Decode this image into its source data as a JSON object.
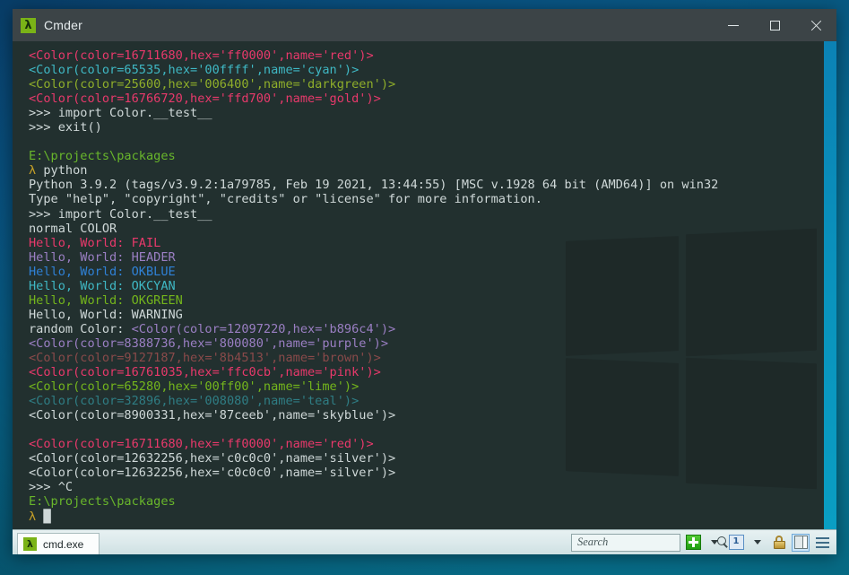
{
  "window": {
    "title": "Cmder",
    "icon": "lambda-icon",
    "buttons": {
      "minimize": "minimize",
      "maximize": "maximize",
      "close": "close"
    }
  },
  "console": {
    "lines": [
      {
        "segments": [
          {
            "t": "<Color(color=16711680,hex='ff0000',name='red')>",
            "c": "#e8396b"
          }
        ]
      },
      {
        "segments": [
          {
            "t": "<Color(color=65535,hex='00ffff',name='cyan')>",
            "c": "#3fb8c4"
          }
        ]
      },
      {
        "segments": [
          {
            "t": "<Color(color=25600,hex='006400',name='darkgreen')>",
            "c": "#8fae2a"
          }
        ]
      },
      {
        "segments": [
          {
            "t": "<Color(color=16766720,hex='ffd700',name='gold')>",
            "c": "#e8396b"
          }
        ]
      },
      {
        "segments": [
          {
            "t": ">>> import Color.__test__",
            "c": "#cfd8d8"
          }
        ]
      },
      {
        "segments": [
          {
            "t": ">>> exit()",
            "c": "#cfd8d8"
          }
        ]
      },
      {
        "segments": [
          {
            "t": "",
            "c": "#cfd8d8"
          }
        ]
      },
      {
        "segments": [
          {
            "t": "E:\\projects\\packages",
            "c": "#69b72b"
          }
        ]
      },
      {
        "segments": [
          {
            "t": "λ ",
            "c": "#c9a227"
          },
          {
            "t": "python",
            "c": "#cfd8d8"
          }
        ]
      },
      {
        "segments": [
          {
            "t": "Python 3.9.2 (tags/v3.9.2:1a79785, Feb 19 2021, 13:44:55) [MSC v.1928 64 bit (AMD64)] on win32",
            "c": "#cfd8d8"
          }
        ]
      },
      {
        "segments": [
          {
            "t": "Type \"help\", \"copyright\", \"credits\" or \"license\" for more information.",
            "c": "#cfd8d8"
          }
        ]
      },
      {
        "segments": [
          {
            "t": ">>> import Color.__test__",
            "c": "#cfd8d8"
          }
        ]
      },
      {
        "segments": [
          {
            "t": "normal COLOR",
            "c": "#cfd8d8"
          }
        ]
      },
      {
        "segments": [
          {
            "t": "Hello, World: FAIL",
            "c": "#e8396b"
          }
        ]
      },
      {
        "segments": [
          {
            "t": "Hello, World: HEADER",
            "c": "#9b7fc4"
          }
        ]
      },
      {
        "segments": [
          {
            "t": "Hello, World: OKBLUE",
            "c": "#2f81d6"
          }
        ]
      },
      {
        "segments": [
          {
            "t": "Hello, World: OKCYAN",
            "c": "#3fb8c4"
          }
        ]
      },
      {
        "segments": [
          {
            "t": "Hello, World: OKGREEN",
            "c": "#74b51c"
          }
        ]
      },
      {
        "segments": [
          {
            "t": "Hello, World: WARNING",
            "c": "#cfd8d8"
          }
        ]
      },
      {
        "segments": [
          {
            "t": "random Color: ",
            "c": "#cfd8d8"
          },
          {
            "t": "<Color(color=12097220,hex='b896c4')>",
            "c": "#9b7fc4"
          }
        ]
      },
      {
        "segments": [
          {
            "t": "<Color(color=8388736,hex='800080',name='purple')>",
            "c": "#9b7fc4"
          }
        ]
      },
      {
        "segments": [
          {
            "t": "<Color(color=9127187,hex='8b4513',name='brown')>",
            "c": "#8a4a4a"
          }
        ]
      },
      {
        "segments": [
          {
            "t": "<Color(color=16761035,hex='ffc0cb',name='pink')>",
            "c": "#e8396b"
          }
        ]
      },
      {
        "segments": [
          {
            "t": "<Color(color=65280,hex='00ff00',name='lime')>",
            "c": "#74b51c"
          }
        ]
      },
      {
        "segments": [
          {
            "t": "<Color(color=32896,hex='008080',name='teal')>",
            "c": "#2f7d84"
          }
        ]
      },
      {
        "segments": [
          {
            "t": "<Color(color=8900331,hex='87ceeb',name='skyblue')>",
            "c": "#cfd8d8"
          }
        ]
      },
      {
        "segments": [
          {
            "t": "",
            "c": "#cfd8d8"
          }
        ]
      },
      {
        "segments": [
          {
            "t": "<Color(color=16711680,hex='ff0000',name='red')>",
            "c": "#e8396b"
          }
        ]
      },
      {
        "segments": [
          {
            "t": "<Color(color=12632256,hex='c0c0c0',name='silver')>",
            "c": "#cfd8d8"
          }
        ]
      },
      {
        "segments": [
          {
            "t": "<Color(color=12632256,hex='c0c0c0',name='silver')>",
            "c": "#cfd8d8"
          }
        ]
      },
      {
        "segments": [
          {
            "t": ">>> ^C",
            "c": "#cfd8d8"
          }
        ]
      },
      {
        "segments": [
          {
            "t": "E:\\projects\\packages",
            "c": "#69b72b"
          }
        ]
      },
      {
        "segments": [
          {
            "t": "λ ",
            "c": "#c9a227"
          },
          {
            "t": "█",
            "c": "#cfd8d8"
          }
        ]
      }
    ]
  },
  "statusbar": {
    "tab": {
      "label": "cmd.exe",
      "icon": "lambda-icon"
    },
    "search": {
      "placeholder": "Search",
      "value": "",
      "icon": "search-icon"
    },
    "buttons": {
      "new_console": "new-console-plus",
      "new_console_menu": "chevron-down-icon",
      "active_console": "1",
      "active_console_menu": "chevron-down-icon",
      "lock": "lock-icon",
      "panel": "panel-view-icon",
      "menu": "hamburger-menu-icon"
    }
  },
  "colors": {
    "window_chrome": "#3c4447",
    "console_bg": "#22302f",
    "accent_green": "#7ab317",
    "desktop_blue": "#0d63a8",
    "desktop_teal": "#0a9cc2"
  }
}
